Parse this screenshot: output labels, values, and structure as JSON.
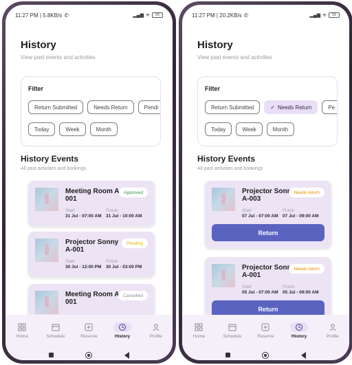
{
  "screens": [
    {
      "status": {
        "time": "11:27 PM | 5.8KB/s",
        "battery": "59"
      },
      "header": {
        "title": "History",
        "subtitle": "View past events and activities"
      },
      "filter": {
        "label": "Filter",
        "row1": [
          {
            "label": "Return Submitted",
            "selected": false
          },
          {
            "label": "Needs Return",
            "selected": false
          },
          {
            "label": "Pendi",
            "selected": false
          }
        ],
        "row2": [
          {
            "label": "Today"
          },
          {
            "label": "Week"
          },
          {
            "label": "Month"
          }
        ]
      },
      "section": {
        "title": "History Events",
        "subtitle": "All past activities and bookings"
      },
      "events": [
        {
          "title": "Meeting Room A 001",
          "status": "Approved",
          "status_color": "#2e9a4a",
          "start_label": "Start",
          "finish_label": "Finish",
          "start": "31 Jul - 07:00 AM",
          "finish": "31 Jul - 10:00 AM"
        },
        {
          "title": "Projector Sonny A-001",
          "status": "Pending",
          "status_color": "#e0b400",
          "start_label": "Start",
          "finish_label": "Finish",
          "start": "30 Jul - 12:00 PM",
          "finish": "30 Jul - 03:00 PM"
        },
        {
          "title": "Meeting Room A 001",
          "status": "Cancelled",
          "status_color": "#8b8791"
        }
      ]
    },
    {
      "status": {
        "time": "11:27 PM | 20.2KB/s",
        "battery": "59"
      },
      "header": {
        "title": "History",
        "subtitle": "View past events and activities"
      },
      "filter": {
        "label": "Filter",
        "row1": [
          {
            "label": "Return Submitted",
            "selected": false
          },
          {
            "label": "Needs Return",
            "selected": true
          },
          {
            "label": "Pe",
            "selected": false
          }
        ],
        "row2": [
          {
            "label": "Today"
          },
          {
            "label": "Week"
          },
          {
            "label": "Month"
          }
        ]
      },
      "section": {
        "title": "History Events",
        "subtitle": "All past activities and bookings"
      },
      "events": [
        {
          "title": "Projector Sonny A-003",
          "status": "Needs return",
          "status_color": "#e08a00",
          "start_label": "Start",
          "finish_label": "Finish",
          "start": "07 Jul - 07:00 AM",
          "finish": "07 Jul - 09:00 AM",
          "action": "Return"
        },
        {
          "title": "Projector Sonny A-001",
          "status": "Needs return",
          "status_color": "#e08a00",
          "start_label": "Start",
          "finish_label": "Finish",
          "start": "05 Jul - 07:00 AM",
          "finish": "05 Jul - 09:00 AM",
          "action": "Return"
        }
      ]
    }
  ],
  "nav": {
    "items": [
      {
        "label": "Home",
        "icon": "home-grid-icon"
      },
      {
        "label": "Schedule",
        "icon": "calendar-icon"
      },
      {
        "label": "Reserve",
        "icon": "plus-square-icon"
      },
      {
        "label": "History",
        "icon": "history-icon",
        "active": true
      },
      {
        "label": "Profile",
        "icon": "person-icon"
      }
    ]
  },
  "colors": {
    "accent": "#5a63c0",
    "card": "#ece4f4",
    "chip_selected": "#e8def8"
  }
}
